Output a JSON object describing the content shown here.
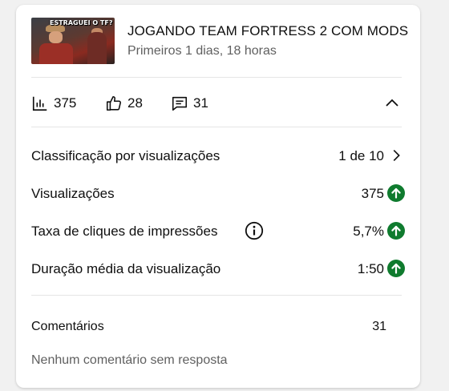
{
  "video": {
    "thumbnail_text": "ESTRAGUEI O TF?",
    "title": "JOGANDO TEAM FORTRESS 2 COM MODS",
    "subtitle": "Primeiros 1 dias, 18 horas"
  },
  "stats": {
    "views": "375",
    "likes": "28",
    "comments": "31"
  },
  "metrics": [
    {
      "label": "Classificação por visualizações",
      "value": "1 de 10",
      "icon": "chevron-right-icon"
    },
    {
      "label": "Visualizações",
      "value": "375",
      "icon": "arrow-up-circle-icon"
    },
    {
      "label": "Taxa de cliques de impressões",
      "value": "5,7%",
      "icon": "arrow-up-circle-icon"
    },
    {
      "label": "Duração média da visualização",
      "value": "1:50",
      "icon": "arrow-up-circle-icon"
    }
  ],
  "comments": {
    "label": "Comentários",
    "value": "31",
    "note": "Nenhum comentário sem resposta"
  },
  "colors": {
    "up_green": "#0f7b2e",
    "text_primary": "#0f0f0f",
    "text_secondary": "#606060",
    "divider": "#e5e5e5"
  }
}
